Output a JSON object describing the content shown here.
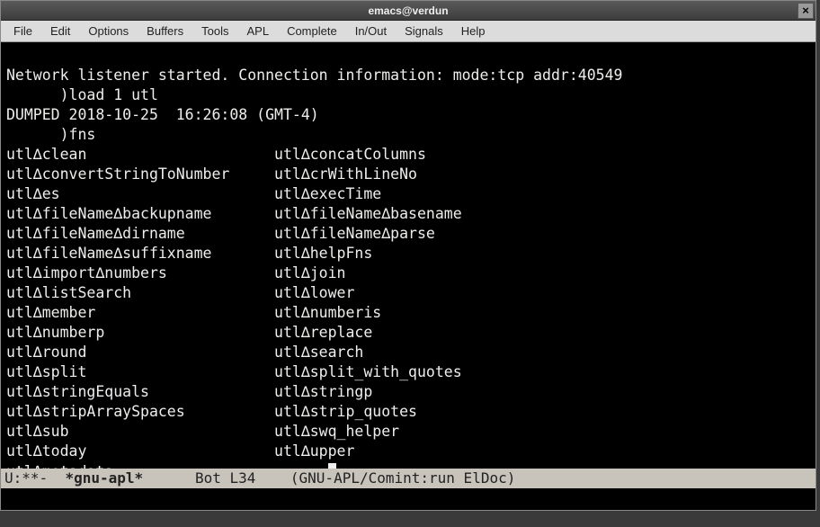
{
  "titlebar": {
    "title": "emacs@verdun",
    "close": "×"
  },
  "menu": [
    "File",
    "Edit",
    "Options",
    "Buffers",
    "Tools",
    "APL",
    "Complete",
    "In/Out",
    "Signals",
    "Help"
  ],
  "terminal": {
    "line1": "Network listener started. Connection information: mode:tcp addr:40549",
    "cmd_load": "      )load 1 utl",
    "dumped": "DUMPED 2018-10-25  16:26:08 (GMT-4)",
    "cmd_fns": "      )fns",
    "fns": [
      [
        "utl∆clean",
        "utl∆concatColumns"
      ],
      [
        "utl∆convertStringToNumber",
        "utl∆crWithLineNo"
      ],
      [
        "utl∆es",
        "utl∆execTime"
      ],
      [
        "utl∆fileName∆backupname",
        "utl∆fileName∆basename"
      ],
      [
        "utl∆fileName∆dirname",
        "utl∆fileName∆parse"
      ],
      [
        "utl∆fileName∆suffixname",
        "utl∆helpFns"
      ],
      [
        "utl∆import∆numbers",
        "utl∆join"
      ],
      [
        "utl∆listSearch",
        "utl∆lower"
      ],
      [
        "utl∆member",
        "utl∆numberis"
      ],
      [
        "utl∆numberp",
        "utl∆replace"
      ],
      [
        "utl∆round",
        "utl∆search"
      ],
      [
        "utl∆split",
        "utl∆split_with_quotes"
      ],
      [
        "utl∆stringEquals",
        "utl∆stringp"
      ],
      [
        "utl∆stripArraySpaces",
        "utl∆strip_quotes"
      ],
      [
        "utl∆sub",
        "utl∆swq_helper"
      ],
      [
        "utl∆today",
        "utl∆upper"
      ],
      [
        "utl⍙metadata",
        ""
      ]
    ],
    "col1_width": 30
  },
  "modeline": {
    "left": "U:**-  ",
    "buffer": "*gnu-apl*",
    "mid": "      Bot L34    (GNU-APL/Comint:run ElDoc)"
  }
}
